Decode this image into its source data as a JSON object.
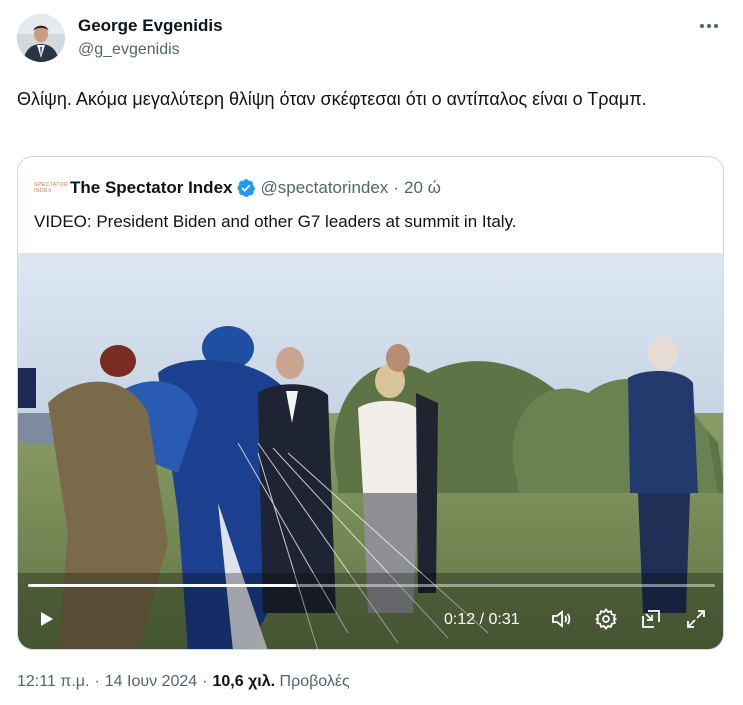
{
  "author": {
    "name": "George Evgenidis",
    "handle": "@g_evgenidis",
    "avatar_icon": "profile-photo"
  },
  "tweet": {
    "text": "Θλίψη. Ακόμα μεγαλύτερη θλίψη όταν σκέφτεσαι ότι ο αντίπαλος είναι ο Τραμπ."
  },
  "quoted": {
    "name": "The Spectator Index",
    "handle": "@spectatorindex",
    "separator": "·",
    "time": "20 ώ",
    "logo_line1": "SPECTATOR",
    "logo_line2": "INDEX",
    "verified_icon": "verified-badge-icon",
    "text": "VIDEO: President Biden and other G7 leaders at summit in Italy."
  },
  "video": {
    "current_time": "0:12",
    "duration": "0:31",
    "time_separator": " / ",
    "progress": 0.39,
    "icons": [
      "play-icon",
      "volume-icon",
      "settings-icon",
      "pip-icon",
      "fullscreen-icon"
    ]
  },
  "footer": {
    "time": "12:11 π.μ.",
    "dot": "·",
    "date": "14 Ιουν 2024",
    "views_count": "10,6 χιλ.",
    "views_label": "Προβολές"
  },
  "colors": {
    "text_primary": "#0f1419",
    "text_secondary": "#536471",
    "border": "#cfd9de",
    "verified": "#1d9bf0"
  }
}
